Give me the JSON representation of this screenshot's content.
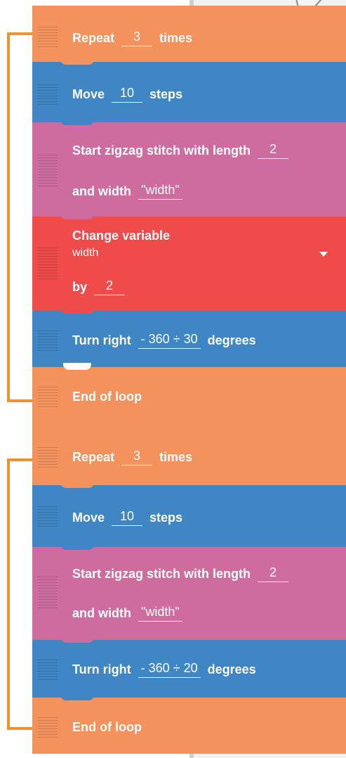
{
  "blocks": [
    {
      "repeat_label": "Repeat",
      "repeat_count": "3",
      "repeat_suffix": "times"
    },
    {
      "move_label": "Move",
      "move_steps": "10",
      "move_suffix": "steps"
    },
    {
      "zigzag_label": "Start zigzag stitch with length",
      "zigzag_length": "2",
      "zigzag_width_label": "and width",
      "zigzag_width": "\"width\""
    },
    {
      "change_label": "Change variable",
      "change_variable": "width",
      "change_by_label": "by",
      "change_by": "2"
    },
    {
      "turn_label": "Turn right",
      "turn_value": "- 360 ÷ 30",
      "turn_suffix": "degrees"
    },
    {
      "end_label": "End of loop"
    },
    {
      "repeat_label": "Repeat",
      "repeat_count": "3",
      "repeat_suffix": "times"
    },
    {
      "move_label": "Move",
      "move_steps": "10",
      "move_suffix": "steps"
    },
    {
      "zigzag_label": "Start zigzag stitch with length",
      "zigzag_length": "2",
      "zigzag_width_label": "and width",
      "zigzag_width": "\"width\""
    },
    {
      "turn_label": "Turn right",
      "turn_value": "- 360 ÷ 20",
      "turn_suffix": "degrees"
    },
    {
      "end_label": "End of loop"
    }
  ],
  "colors": {
    "loop": "#f4925e",
    "motion": "#3f86c5",
    "stitch": "#cf6c9f",
    "variable": "#ef4b4b",
    "bracket": "#f0932f"
  },
  "icons": [
    "drag-handle-icon",
    "chevron-down-icon",
    "speech-bubble-icon"
  ]
}
